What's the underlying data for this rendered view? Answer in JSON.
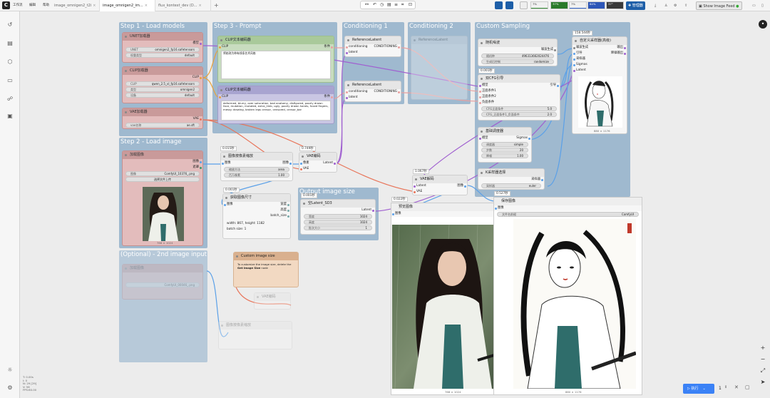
{
  "topbar": {
    "menus": [
      "工作流",
      "编辑",
      "帮助"
    ],
    "tabs": [
      {
        "label": "image_omnigen2_t2i",
        "active": false
      },
      {
        "label": "image_omnigen2_im...",
        "active": true
      },
      {
        "label": "flux_kontext_dev (D...",
        "active": false
      }
    ],
    "new_tab": "+",
    "monitors": [
      {
        "label": "7%",
        "sub": "CPU",
        "color": "#3a8f3a",
        "level": 0.07
      },
      {
        "label": "37%",
        "sub": "RAM",
        "color": "#2a7a2a",
        "level": 0.37
      },
      {
        "label": "7%",
        "sub": "GPU",
        "color": "#3a6ad0",
        "level": 0.07
      },
      {
        "label": "84%",
        "sub": "VRAM",
        "color": "#c04040",
        "level": 0.84
      },
      {
        "label": "37°",
        "sub": "TEMP",
        "color": "#a0a060",
        "level": 0.37
      }
    ],
    "manager_label": "管理器",
    "show_feed_label": "Show Image Feed"
  },
  "groups": {
    "load_models": "Step 1 - Load models",
    "prompt": "Step 3 - Prompt",
    "cond1": "Conditioning 1",
    "cond2": "Conditioning 2",
    "sampling": "Custom Sampling",
    "load_image": "Step 2 - Load image",
    "output_size": "Output image size",
    "second_image": "(Optional) - 2nd image input"
  },
  "nodes": {
    "unet": {
      "title": "UNET加载器",
      "out": "模型",
      "w1_l": "UNET",
      "w1_r": "omnigen2_fp16.safetensors",
      "w2_l": "权重类型",
      "w2_r": "default"
    },
    "clip_loader": {
      "title": "CLIP加载器",
      "out": "CLIP",
      "w1_l": "CLIP",
      "w1_r": "qwen_2.5_vl_fp16.safetensors",
      "w2_l": "类型",
      "w2_r": "omnigen2",
      "w3_l": "设备",
      "w3_r": "default"
    },
    "vae_loader": {
      "title": "VAE加载器",
      "out": "VAE",
      "w1_l": "vae名称",
      "w1_r": "ae.sft"
    },
    "clip_pos": {
      "title": "CLIP文本编码器",
      "in": "CLIP",
      "out": "条件",
      "text": "将她改为带有线条艺术风格"
    },
    "clip_neg": {
      "title": "CLIP文本编码器",
      "in": "CLIP",
      "out": "条件",
      "text": "deformed, blurry, over saturation, bad anatomy, disfigured, poorly drawn face, mutation, mutated, extra_limb, ugly, poorly drawn hands, fused fingers, messy drawing, broken legs censor, censored, censor_bar"
    },
    "ref1": {
      "title": "ReferenceLatent",
      "in1": "conditioning",
      "out1": "CONDITIONING",
      "in2": "latent"
    },
    "ref2": {
      "title": "ReferenceLatent",
      "in1": "conditioning",
      "out1": "CONDITIONING",
      "in2": "latent"
    },
    "ref3": {
      "title": "ReferenceLatent"
    },
    "noise": {
      "title": "随机噪波",
      "out": "噪波生成",
      "w1_l": "随机种",
      "w1_r": "496313662024476",
      "w2_l": "生成后控制",
      "w2_r": "randomize"
    },
    "cfg": {
      "badge": "0.001秒",
      "title": "双CFG引导",
      "in1": "模型",
      "in2": "正面条件1",
      "in3": "正面条件2",
      "in4": "负面条件",
      "out": "引导",
      "w1_l": "CFG正面条件",
      "w1_r": "5.0",
      "w2_l": "CFG_正面条件1_负面条件",
      "w2_r": "2.0"
    },
    "sched": {
      "title": "基础调度器",
      "in": "模型",
      "out": "Sigmas",
      "w1_l": "调度器",
      "w1_r": "simple",
      "w2_l": "步数",
      "w2_r": "20",
      "w3_l": "降噪",
      "w3_r": "1.00"
    },
    "ksampler": {
      "title": "K采样器选择",
      "out": "采样器",
      "w1_l": "采样器",
      "w1_r": "euler"
    },
    "custom_sampler": {
      "badge": "158.544秒",
      "title": "自定义采样器(高级)",
      "in1": "噪波生成",
      "in2": "引导",
      "in3": "采样器",
      "in4": "Sigmas",
      "in5": "Latent",
      "out1": "输出",
      "out2": "降噪输出",
      "caption": "880 × 1176"
    },
    "load_img": {
      "title": "加载图像",
      "out1": "图像",
      "out2": "遮罩",
      "w1_l": "图像",
      "w1_r": "ComfyUI_10376_.png",
      "btn": "选择文件上传",
      "caption": "768 × 1024"
    },
    "scale": {
      "badge": "0.015秒",
      "title": "图像按像素缩放",
      "in": "图像",
      "out": "图像",
      "w1_l": "缩放方法",
      "w1_r": "area",
      "w2_l": "百万像素",
      "w2_r": "1.00"
    },
    "vae_enc1": {
      "badge": "0.749秒",
      "title": "VAE编码",
      "in1": "像素",
      "in2": "VAE",
      "out": "Latent"
    },
    "get_size": {
      "badge": "0.001秒",
      "title": "获取图像尺寸",
      "in": "图像",
      "out1": "宽度",
      "out2": "高度",
      "out3": "batch_size",
      "info1": "width: 867, height: 1182",
      "info2": "batch size: 1"
    },
    "empty_latent": {
      "badge": "0.001秒",
      "title": "空Latent_SD3",
      "out": "Latent",
      "w1_l": "宽度",
      "w1_r": "1024",
      "w2_l": "高度",
      "w2_r": "1024",
      "w3_l": "批次大小",
      "w3_r": "1"
    },
    "vae_dec": {
      "badge": "1.067秒",
      "title": "VAE解码",
      "in1": "Latent",
      "in2": "VAE",
      "out": "图像"
    },
    "save": {
      "badge": "0.527秒",
      "title": "保存图像",
      "in": "图像",
      "w1_l": "文件名前缀",
      "w1_r": "ComfyUI",
      "caption": "880 × 1176"
    },
    "preview": {
      "badge": "0.022秒",
      "title": "预览图像",
      "in": "图像",
      "caption": "768 × 1024"
    },
    "custom_note": {
      "title": "Custom image size",
      "text1": "To customize the image size, delete the",
      "text2": "Get Image Size",
      "text3": "node"
    },
    "load_img2": {
      "title": "加载图像",
      "w1_r": "ComfyUI_00046_.png"
    },
    "vae_enc2": {
      "title": "VAE编码"
    },
    "scale2": {
      "title": "图像按像素缩放"
    }
  },
  "queue": {
    "label": "执行",
    "count": "1"
  },
  "stats": [
    "T: 0.00s",
    "I: 0",
    "N: 29 [29]",
    "V: 56",
    "FPS:60.00"
  ],
  "colors": {
    "accent": "#3b82f6",
    "group_blue": "#8fb3cf",
    "node_red": "#e3bcbc",
    "node_green": "#c8dcbf",
    "node_purple": "#c9c6e3",
    "link_red": "#e8755a",
    "link_purple": "#a060d0",
    "link_blue": "#5aa0e8"
  }
}
